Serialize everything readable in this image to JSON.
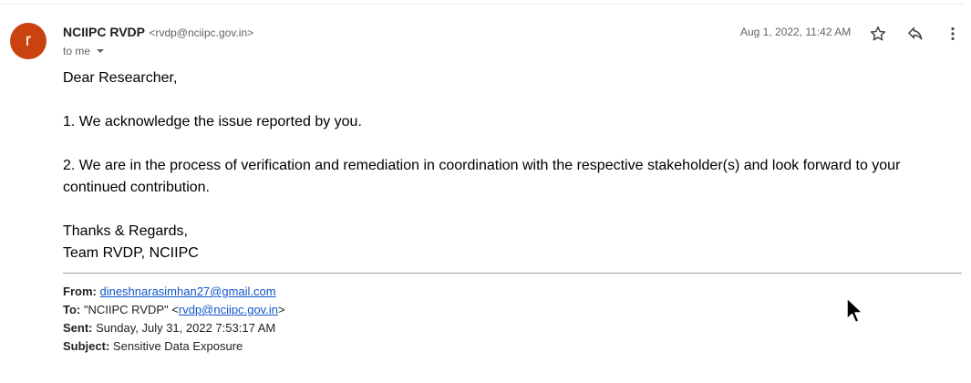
{
  "email": {
    "avatar_letter": "r",
    "sender_name": "NCIIPC RVDP",
    "sender_email": "<rvdp@nciipc.gov.in>",
    "to_label": "to me",
    "date": "Aug 1, 2022, 11:42 AM",
    "icons": {
      "star": "star-icon",
      "reply": "reply-icon",
      "more": "more-vert-icon",
      "caret": "chevron-down-icon"
    },
    "colors": {
      "avatar_bg": "#c9420f",
      "link": "#1155cc"
    },
    "body": {
      "greeting": "Dear Researcher,",
      "point1": "1. We acknowledge the issue reported by you.",
      "point2": "2. We are in the process of verification and remediation in coordination with the respective stakeholder(s) and look forward to your continued contribution.",
      "signoff_line1": "Thanks & Regards,",
      "signoff_line2": "Team RVDP, NCIIPC"
    },
    "quoted_header": {
      "from_label": "From:",
      "from_value": "dineshnarasimhan27@gmail.com",
      "to_label": "To:",
      "to_name": "\"NCIIPC RVDP\" <",
      "to_link": "rvdp@nciipc.gov.in",
      "to_suffix": ">",
      "sent_label": "Sent:",
      "sent_value": "Sunday, July 31, 2022 7:53:17 AM",
      "subject_label": "Subject:",
      "subject_value": "Sensitive Data Exposure"
    }
  }
}
